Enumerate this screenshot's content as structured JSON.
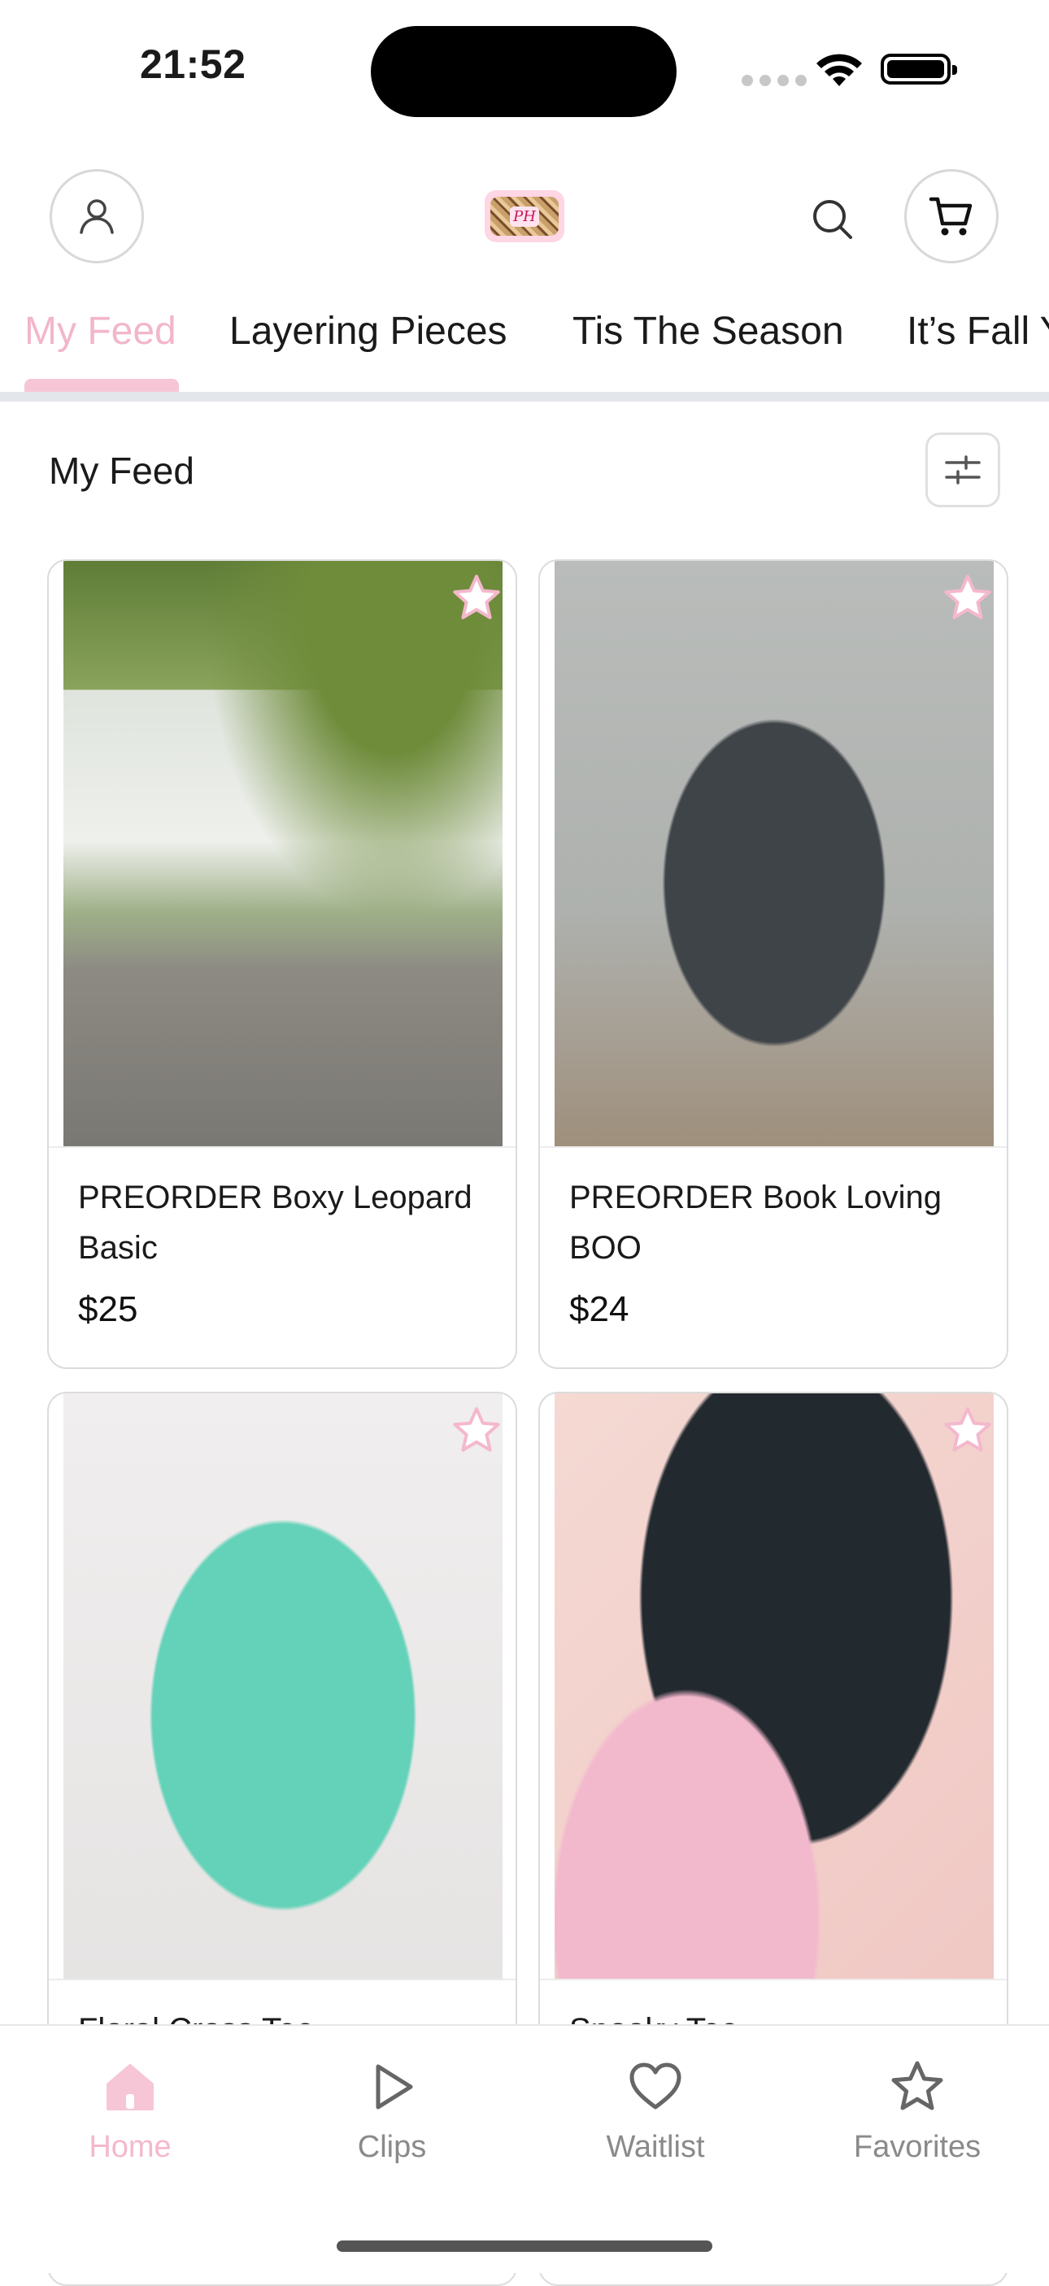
{
  "status_bar": {
    "time": "21:52"
  },
  "header": {
    "logo_alt": "Pink Halo Boutique",
    "account_icon": "user-icon",
    "search_icon": "search-icon",
    "cart_icon": "cart-icon"
  },
  "tabs": [
    {
      "label": "My Feed",
      "active": true
    },
    {
      "label": "Layering Pieces",
      "active": false
    },
    {
      "label": "Tis The Season",
      "active": false
    },
    {
      "label": "It’s Fall Y",
      "active": false
    }
  ],
  "feed": {
    "title": "My Feed",
    "filter_icon": "sliders-icon",
    "products": [
      {
        "name": "PREORDER Boxy Leopard Basic",
        "price": "$25"
      },
      {
        "name": "PREORDER Book Loving BOO",
        "price": "$24"
      },
      {
        "name": "Floral Cross Tee",
        "price": ""
      },
      {
        "name": "Spooky Tee",
        "price": ""
      }
    ]
  },
  "bottom_nav": [
    {
      "label": "Home",
      "icon": "home-icon",
      "active": true
    },
    {
      "label": "Clips",
      "icon": "play-icon",
      "active": false
    },
    {
      "label": "Waitlist",
      "icon": "heart-icon",
      "active": false
    },
    {
      "label": "Favorites",
      "icon": "star-icon",
      "active": false
    }
  ],
  "colors": {
    "accent_pink": "#f4b8cd",
    "text_dark": "#1a1a1a",
    "muted": "#8a8a8a"
  }
}
